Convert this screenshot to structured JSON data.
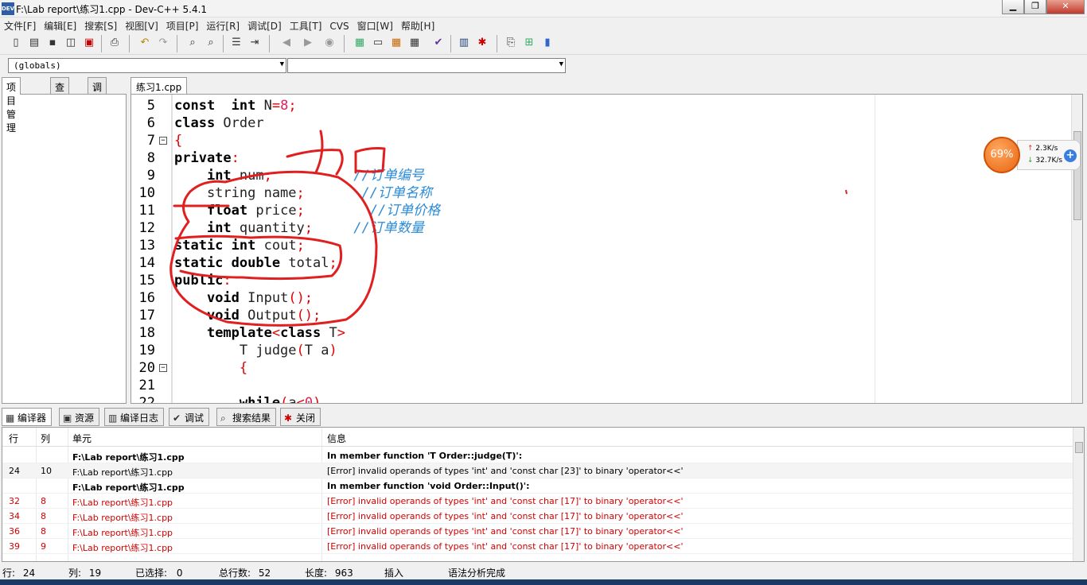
{
  "window": {
    "title": "F:\\Lab report\\练习1.cpp - Dev-C++ 5.4.1",
    "min": "▁",
    "max": "❐",
    "close": "✕"
  },
  "menu": [
    "文件[F]",
    "编辑[E]",
    "搜索[S]",
    "视图[V]",
    "项目[P]",
    "运行[R]",
    "调试[D]",
    "工具[T]",
    "CVS",
    "窗口[W]",
    "帮助[H]"
  ],
  "toolbar_icons": [
    "new-file-icon",
    "open-icon",
    "save-icon",
    "save-all-icon",
    "close-file-icon",
    "print-icon",
    "undo-icon",
    "redo-icon",
    "find-icon",
    "replace-icon",
    "indent-icon",
    "unindent-icon",
    "back-icon",
    "forward-icon",
    "bookmark-icon",
    "compile-icon",
    "run-icon",
    "compile-run-icon",
    "rebuild-icon",
    "check-icon",
    "chart-icon",
    "debug-icon",
    "new-project-icon",
    "add-file-icon",
    "remove-file-icon"
  ],
  "selector": {
    "scope": "(globals)",
    "member": ""
  },
  "left_tabs": [
    "项目管理",
    "查看类",
    "调试"
  ],
  "editor_tab": "练习1.cpp",
  "code_lines": [
    {
      "n": "5",
      "fold": ""
    },
    {
      "n": "6",
      "fold": ""
    },
    {
      "n": "7",
      "fold": "−"
    },
    {
      "n": "8",
      "fold": ""
    },
    {
      "n": "9",
      "fold": ""
    },
    {
      "n": "10",
      "fold": ""
    },
    {
      "n": "11",
      "fold": ""
    },
    {
      "n": "12",
      "fold": ""
    },
    {
      "n": "13",
      "fold": ""
    },
    {
      "n": "14",
      "fold": ""
    },
    {
      "n": "15",
      "fold": ""
    },
    {
      "n": "16",
      "fold": ""
    },
    {
      "n": "17",
      "fold": ""
    },
    {
      "n": "18",
      "fold": ""
    },
    {
      "n": "19",
      "fold": ""
    },
    {
      "n": "20",
      "fold": "−"
    },
    {
      "n": "21",
      "fold": ""
    },
    {
      "n": "22",
      "fold": ""
    }
  ],
  "code": {
    "l5": [
      "const",
      "  ",
      "int",
      " N",
      "=",
      "8",
      ";"
    ],
    "l6": [
      "class",
      " Order"
    ],
    "l7": [
      "{"
    ],
    "l8": [
      "private",
      ":"
    ],
    "l9": [
      "    ",
      "int",
      " num",
      ";",
      "          ",
      "//订单编号"
    ],
    "l10": [
      "    string name",
      ";",
      "       ",
      "//订单名称"
    ],
    "l11": [
      "    ",
      "float",
      " price",
      ";",
      "        ",
      "//订单价格"
    ],
    "l12": [
      "    ",
      "int",
      " quantity",
      ";",
      "     ",
      "//订单数量"
    ],
    "l13": [
      "static",
      " ",
      "int",
      " cout",
      ";"
    ],
    "l14": [
      "static",
      " ",
      "double",
      " total",
      ";"
    ],
    "l15": [
      "public",
      ":"
    ],
    "l16": [
      "    ",
      "void",
      " Input",
      "();"
    ],
    "l17": [
      "    ",
      "void",
      " Output",
      "();"
    ],
    "l18": [
      "    ",
      "template",
      "<",
      "class",
      " T",
      ">"
    ],
    "l19": [
      "        T judge",
      "(",
      "T a",
      ")"
    ],
    "l20": [
      "        ",
      "{"
    ],
    "l21": [
      ""
    ],
    "l22": [
      "        ",
      "while",
      "(",
      "a",
      "<",
      "0",
      ")"
    ]
  },
  "annotation_text": "加",
  "bottom_tabs": [
    {
      "label": "编译器",
      "icon": "grid-icon"
    },
    {
      "label": "资源",
      "icon": "resource-icon"
    },
    {
      "label": "编译日志",
      "icon": "chart-icon"
    },
    {
      "label": "调试",
      "icon": "check-icon"
    },
    {
      "label": "搜索结果",
      "icon": "search-icon"
    },
    {
      "label": "关闭",
      "icon": "close-icon"
    }
  ],
  "messages": {
    "headers": [
      "行",
      "列",
      "单元",
      "信息"
    ],
    "rows": [
      {
        "line": "",
        "col": "",
        "unit": "F:\\Lab report\\练习1.cpp",
        "msg": "In member function 'T Order::judge(T)':",
        "kind": "bold"
      },
      {
        "line": "24",
        "col": "10",
        "unit": "F:\\Lab report\\练习1.cpp",
        "msg": "[Error] invalid operands of types 'int' and 'const char [23]' to binary 'operator<<'",
        "kind": "normal"
      },
      {
        "line": "",
        "col": "",
        "unit": "F:\\Lab report\\练习1.cpp",
        "msg": "In member function 'void Order::Input()':",
        "kind": "bold"
      },
      {
        "line": "32",
        "col": "8",
        "unit": "F:\\Lab report\\练习1.cpp",
        "msg": "[Error] invalid operands of types 'int' and 'const char [17]' to binary 'operator<<'",
        "kind": "err"
      },
      {
        "line": "34",
        "col": "8",
        "unit": "F:\\Lab report\\练习1.cpp",
        "msg": "[Error] invalid operands of types 'int' and 'const char [17]' to binary 'operator<<'",
        "kind": "err"
      },
      {
        "line": "36",
        "col": "8",
        "unit": "F:\\Lab report\\练习1.cpp",
        "msg": "[Error] invalid operands of types 'int' and 'const char [17]' to binary 'operator<<'",
        "kind": "err"
      },
      {
        "line": "39",
        "col": "9",
        "unit": "F:\\Lab report\\练习1.cpp",
        "msg": "[Error] invalid operands of types 'int' and 'const char [17]' to binary 'operator<<'",
        "kind": "err"
      }
    ]
  },
  "status": {
    "row_label": "行:",
    "row": "24",
    "col_label": "列:",
    "col": "19",
    "sel_label": "已选择:",
    "sel": "0",
    "total_label": "总行数:",
    "total": "52",
    "len_label": "长度:",
    "len": "963",
    "mode": "插入",
    "parse": "语法分析完成"
  },
  "widget": {
    "percent": "69%",
    "up": "2.3K/s",
    "down": "32.7K/s",
    "plus": "+"
  },
  "colors": {
    "keyword": "#000000",
    "operator": "#e00000",
    "number": "#e0205a",
    "comment": "#2b8bd6",
    "annotation": "#e02020",
    "error": "#d40000"
  }
}
